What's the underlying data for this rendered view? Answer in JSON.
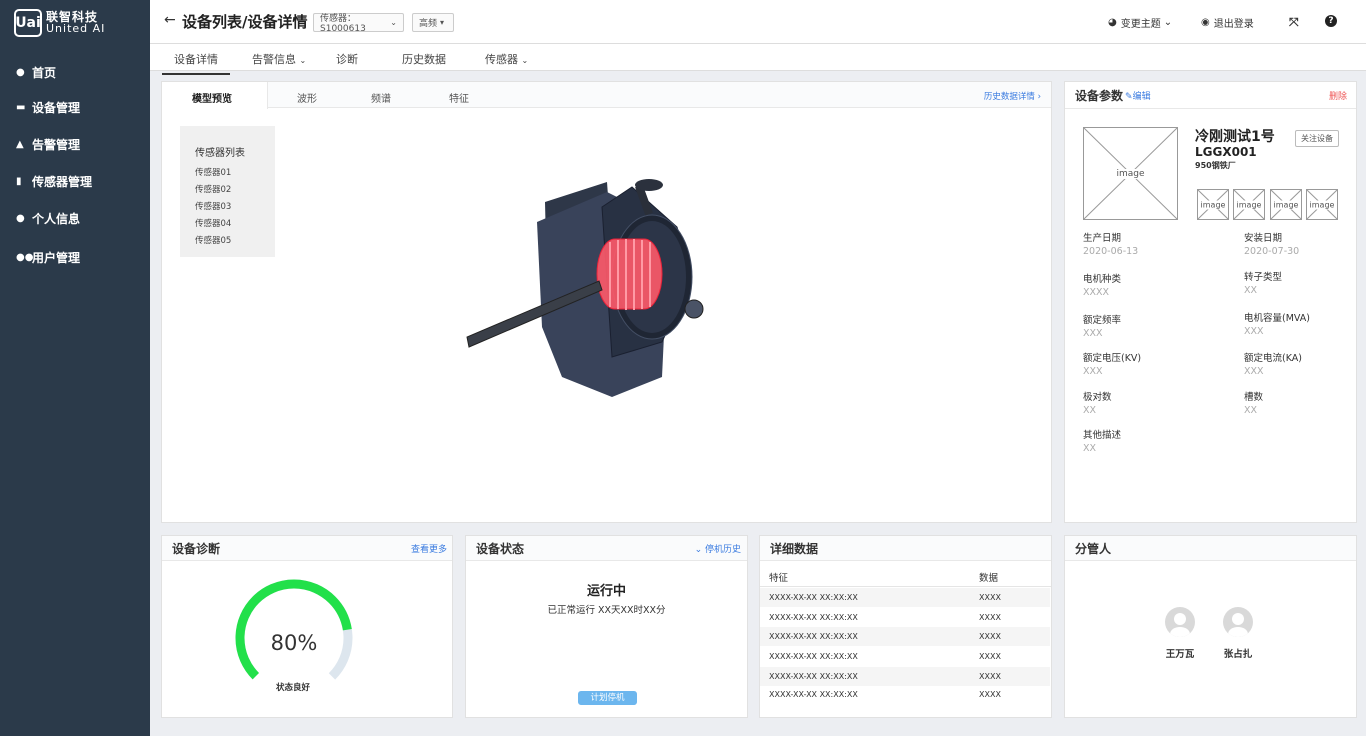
{
  "sidebar": {
    "logo": {
      "mark": "Uai",
      "cn": "联智科技",
      "en": "United AI"
    },
    "items": [
      {
        "label": "首页",
        "icon": "map-pin-icon"
      },
      {
        "label": "设备管理",
        "icon": "folder-icon"
      },
      {
        "label": "告警管理",
        "icon": "warning-icon"
      },
      {
        "label": "传感器管理",
        "icon": "sensor-icon"
      },
      {
        "label": "个人信息",
        "icon": "user-icon"
      },
      {
        "label": "用户管理",
        "icon": "users-icon"
      }
    ]
  },
  "header": {
    "title": "设备列表/设备详情",
    "sensor_select": "传感器：S1000613",
    "freq_select": "高频",
    "theme": "变更主题",
    "logout": "退出登录"
  },
  "tabs": [
    "设备详情",
    "告警信息",
    "诊断",
    "历史数据",
    "传感器"
  ],
  "model_card": {
    "tabs": [
      "模型预览",
      "波形",
      "频谱",
      "特征"
    ],
    "history_link": "历史数据详情",
    "sensor_list_title": "传感器列表",
    "sensors": [
      "传感器01",
      "传感器02",
      "传感器03",
      "传感器04",
      "传感器05"
    ]
  },
  "params": {
    "title": "设备参数",
    "edit": "编辑",
    "delete": "删除",
    "name": "冷刚测试1号",
    "code": "LGGX001",
    "factory": "950钢铁厂",
    "follow": "关注设备",
    "image_label": "image",
    "fields": [
      {
        "label": "生产日期",
        "value": "2020-06-13"
      },
      {
        "label": "安装日期",
        "value": "2020-07-30"
      },
      {
        "label": "电机种类",
        "value": "XXXX"
      },
      {
        "label": "转子类型",
        "value": "XX"
      },
      {
        "label": "额定频率",
        "value": "XXX"
      },
      {
        "label": "电机容量(MVA)",
        "value": "XXX"
      },
      {
        "label": "额定电压(KV)",
        "value": "XXX"
      },
      {
        "label": "额定电流(KA)",
        "value": "XXX"
      },
      {
        "label": "极对数",
        "value": "XX"
      },
      {
        "label": "槽数",
        "value": "XX"
      },
      {
        "label": "其他描述",
        "value": "XX"
      }
    ]
  },
  "diagnosis": {
    "title": "设备诊断",
    "more": "查看更多",
    "percent": 80,
    "percent_text": "80%",
    "status": "状态良好",
    "color": "#22e04a"
  },
  "status": {
    "title": "设备状态",
    "history": "停机历史",
    "state": "运行中",
    "detail": "已正常运行 XX天XX时XX分",
    "button": "计划停机"
  },
  "detail": {
    "title": "详细数据",
    "columns": [
      "特征",
      "数据"
    ],
    "rows": [
      [
        "XXXX-XX-XX XX:XX:XX",
        "XXXX"
      ],
      [
        "XXXX-XX-XX XX:XX:XX",
        "XXXX"
      ],
      [
        "XXXX-XX-XX XX:XX:XX",
        "XXXX"
      ],
      [
        "XXXX-XX-XX XX:XX:XX",
        "XXXX"
      ],
      [
        "XXXX-XX-XX XX:XX:XX",
        "XXXX"
      ],
      [
        "XXXX-XX-XX XX:XX:XX",
        "XXXX"
      ]
    ]
  },
  "managers": {
    "title": "分管人",
    "people": [
      "王万瓦",
      "张占扎"
    ]
  }
}
